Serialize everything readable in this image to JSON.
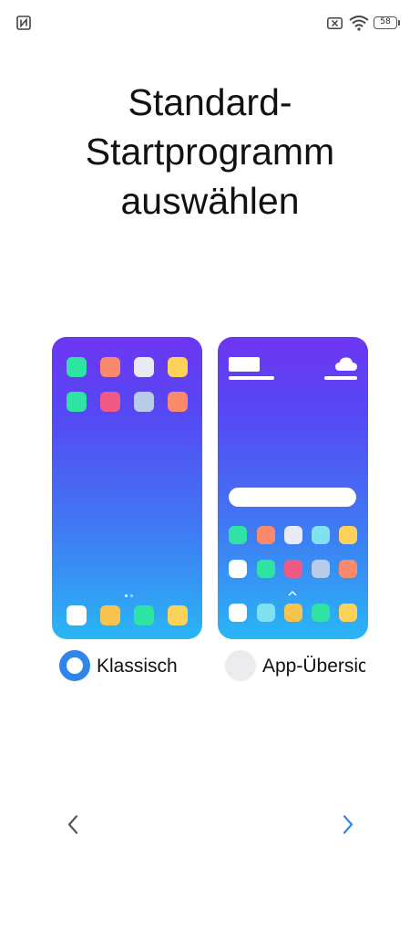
{
  "status_bar": {
    "battery_level": "58",
    "icons": [
      "nfc-icon",
      "sim-x-icon",
      "wifi-icon",
      "battery-icon"
    ]
  },
  "page": {
    "title": "Standard-Startprogramm auswählen",
    "title_lines": [
      "Standard-",
      "Startprogramm",
      "auswählen"
    ]
  },
  "launcher_options": [
    {
      "label": "Klassisch",
      "selected": true
    },
    {
      "label": "App-Übersicht",
      "selected": false
    }
  ],
  "navigation": {
    "back_icon": "chevron-left-icon",
    "next_icon": "chevron-right-icon",
    "back_color": "#555555",
    "next_color": "#2f86e8"
  },
  "colors": {
    "accent": "#2f86e8",
    "preview_gradient": [
      "#6d36f2",
      "#3e7cf3",
      "#2ab6f5"
    ],
    "app_icon_colors": [
      "#2fe3a4",
      "#fb8a6d",
      "#e8eaf6",
      "#fdd25a",
      "#f05b86",
      "#b8cce8",
      "#ffffff",
      "#f7c54f",
      "#7ee2f0"
    ]
  }
}
